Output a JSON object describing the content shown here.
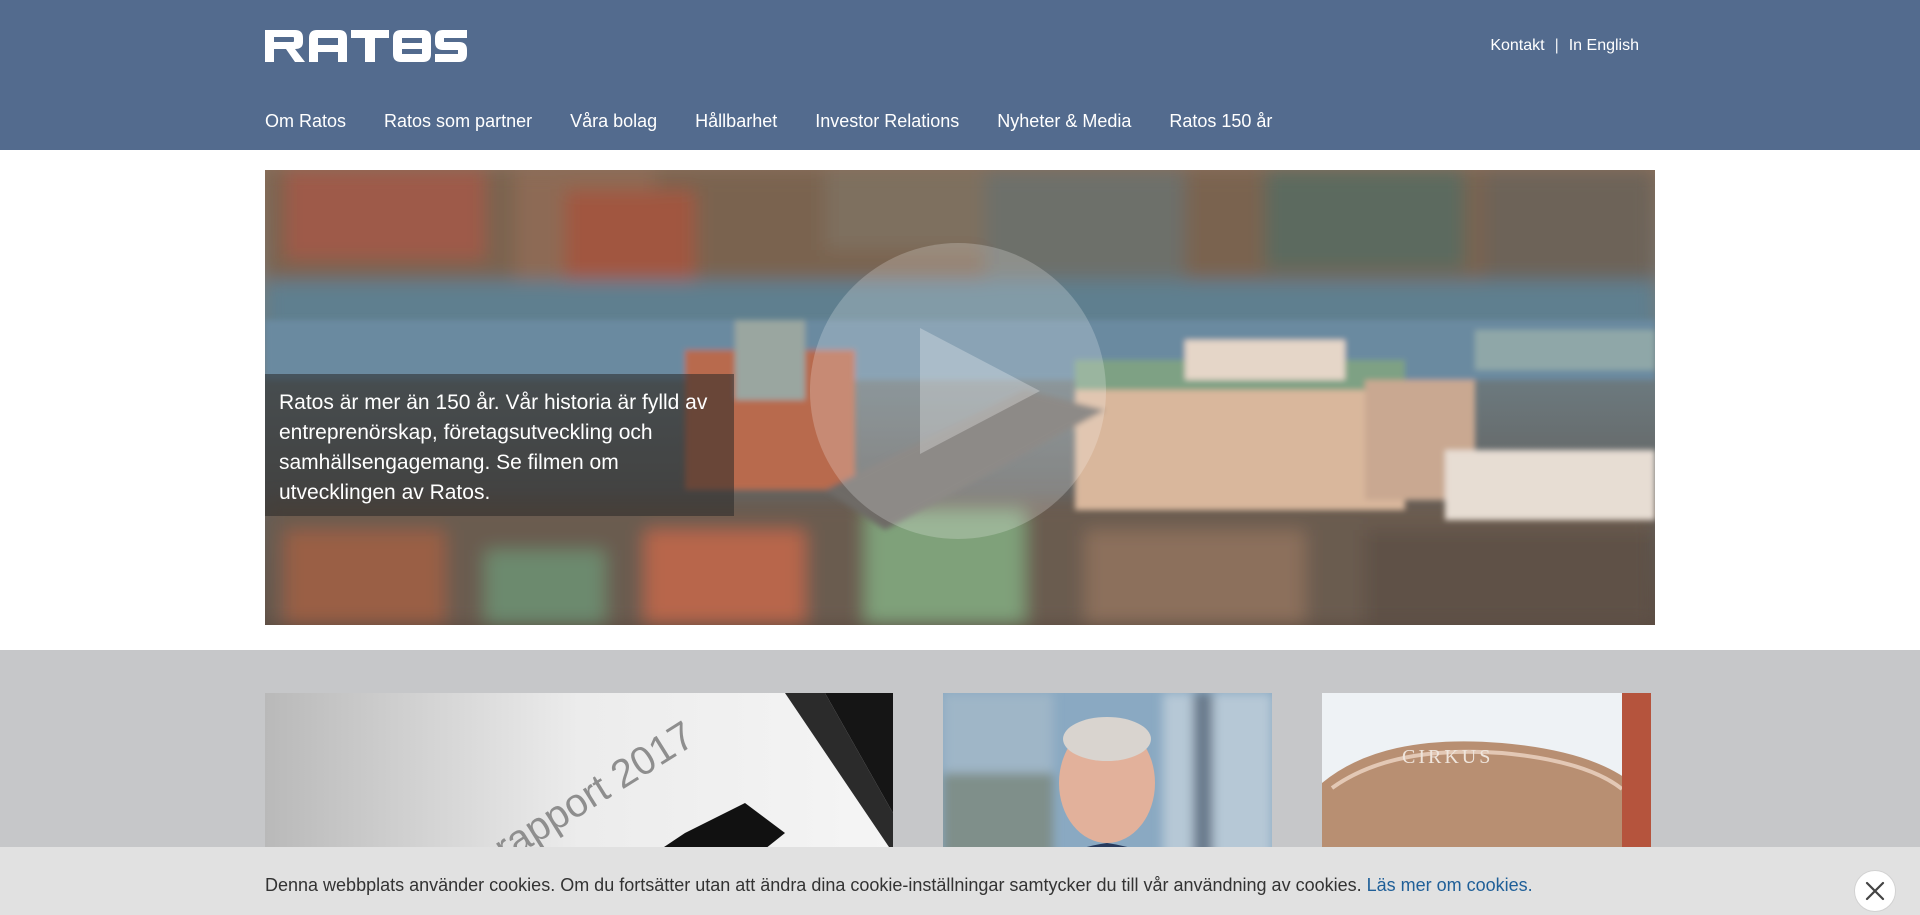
{
  "header": {
    "logo_text": "RATOS",
    "top_links": [
      {
        "label": "Kontakt"
      },
      {
        "label": "In English"
      }
    ],
    "separator": "|",
    "nav": [
      {
        "label": "Om Ratos"
      },
      {
        "label": "Ratos som partner"
      },
      {
        "label": "Våra bolag"
      },
      {
        "label": "Hållbarhet"
      },
      {
        "label": "Investor Relations"
      },
      {
        "label": "Nyheter & Media"
      },
      {
        "label": "Ratos 150 år"
      }
    ]
  },
  "hero": {
    "caption": "Ratos är mer än 150 år. Vår historia är fylld av entreprenörskap, företagsutveckling och samhällsengagemang. Se filmen om utvecklingen av Ratos.",
    "play_icon": "play-icon"
  },
  "cards": [
    {
      "image": "annual-report-image",
      "image_text": "rapport 2017"
    },
    {
      "image": "ceo-portrait-image"
    },
    {
      "image": "cirkus-building-image",
      "image_text": "CIRKUS"
    }
  ],
  "cookie_bar": {
    "message": "Denna webbplats använder cookies. Om du fortsätter utan att ändra dina cookie-inställningar samtycker du till vår användning av cookies.",
    "link_label": "Läs mer om cookies.",
    "close_icon": "close-icon"
  },
  "colors": {
    "header_bg": "#536b8e",
    "lower_bg": "#c6c7c9",
    "cookie_bg": "#e1e1e1",
    "link": "#1f5f98"
  }
}
